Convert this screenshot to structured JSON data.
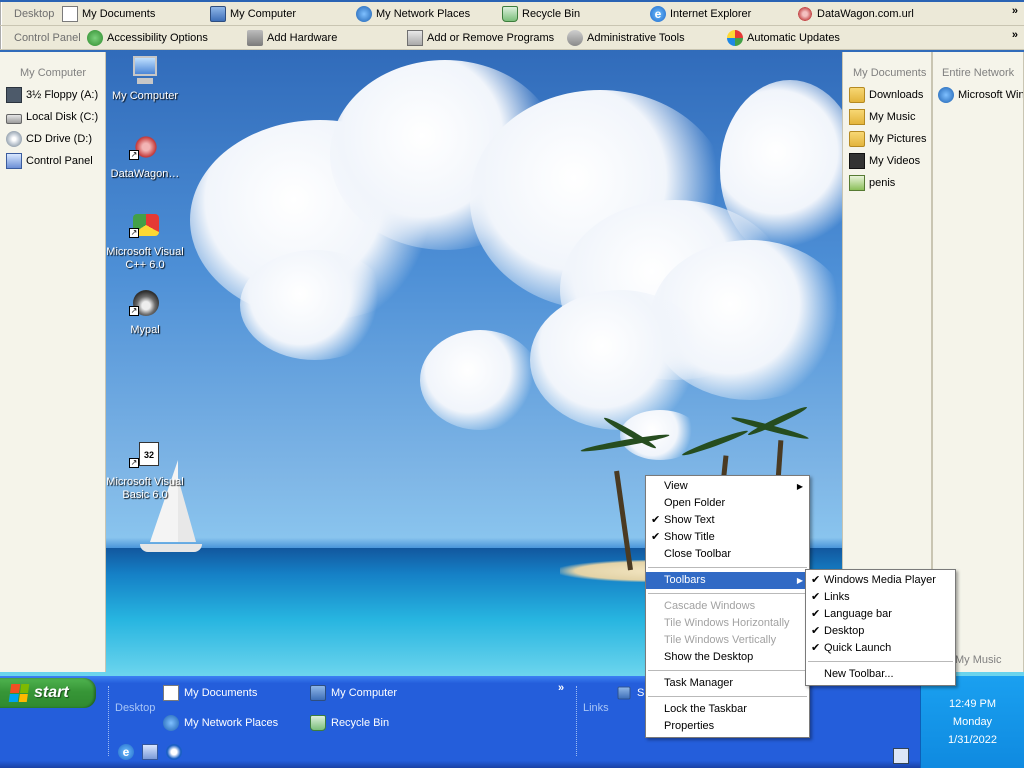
{
  "top_toolbar_1": {
    "label": "Desktop",
    "items": [
      {
        "label": "My Documents",
        "icon": "documents-folder-icon"
      },
      {
        "label": "My Computer",
        "icon": "computer-icon"
      },
      {
        "label": "My Network Places",
        "icon": "network-places-icon"
      },
      {
        "label": "Recycle Bin",
        "icon": "recycle-bin-icon"
      },
      {
        "label": "Internet Explorer",
        "icon": "internet-explorer-icon"
      },
      {
        "label": "DataWagon.com.url",
        "icon": "url-shortcut-icon"
      }
    ],
    "chevron": "»"
  },
  "top_toolbar_2": {
    "label": "Control Panel",
    "items": [
      {
        "label": "Accessibility Options",
        "icon": "accessibility-icon"
      },
      {
        "label": "Add Hardware",
        "icon": "add-hardware-icon"
      },
      {
        "label": "Add or Remove Programs",
        "icon": "add-remove-programs-icon"
      },
      {
        "label": "Administrative Tools",
        "icon": "admin-tools-icon"
      },
      {
        "label": "Automatic Updates",
        "icon": "automatic-updates-icon"
      }
    ],
    "chevron": "»"
  },
  "left_panel": {
    "title": "My Computer",
    "items": [
      {
        "label": "3½ Floppy (A:)",
        "icon": "floppy-icon"
      },
      {
        "label": "Local Disk (C:)",
        "icon": "hard-disk-icon"
      },
      {
        "label": "CD Drive (D:)",
        "icon": "cd-drive-icon"
      },
      {
        "label": "Control Panel",
        "icon": "control-panel-icon"
      }
    ]
  },
  "right_panel_docs": {
    "title": "My Documents",
    "items": [
      {
        "label": "Downloads",
        "icon": "folder-icon"
      },
      {
        "label": "My Music",
        "icon": "music-folder-icon"
      },
      {
        "label": "My Pictures",
        "icon": "pictures-folder-icon"
      },
      {
        "label": "My Videos",
        "icon": "videos-folder-icon"
      },
      {
        "label": "penis",
        "icon": "image-file-icon"
      }
    ]
  },
  "right_panel_network": {
    "title": "Entire Network",
    "items": [
      {
        "label": "Microsoft Win",
        "icon": "network-icon"
      }
    ]
  },
  "right_panel_music_label": "My Music",
  "desktop_icons": [
    {
      "label": "My Computer",
      "icon": "my-computer-desktop-icon"
    },
    {
      "label": "DataWagon…",
      "icon": "datawagon-shortcut-icon"
    },
    {
      "label": "Microsoft Visual C++ 6.0",
      "icon": "visual-cpp-icon"
    },
    {
      "label": "Mypal",
      "icon": "mypal-browser-icon"
    },
    {
      "label": "Microsoft Visual Basic 6.0",
      "icon": "visual-basic-icon"
    }
  ],
  "context_menu": {
    "items": [
      {
        "label": "View",
        "submenu": true
      },
      {
        "label": "Open Folder"
      },
      {
        "label": "Show Text",
        "checked": true
      },
      {
        "label": "Show Title",
        "checked": true
      },
      {
        "label": "Close Toolbar"
      },
      {
        "label": "Toolbars",
        "submenu": true,
        "highlighted": true
      },
      {
        "label": "Cascade Windows",
        "disabled": true
      },
      {
        "label": "Tile Windows Horizontally",
        "disabled": true
      },
      {
        "label": "Tile Windows Vertically",
        "disabled": true
      },
      {
        "label": "Show the Desktop"
      },
      {
        "label": "Task Manager"
      },
      {
        "label": "Lock the Taskbar"
      },
      {
        "label": "Properties"
      }
    ]
  },
  "toolbars_submenu": {
    "items": [
      {
        "label": "Windows Media Player",
        "checked": true
      },
      {
        "label": "Links",
        "checked": true
      },
      {
        "label": "Language bar",
        "checked": true
      },
      {
        "label": "Desktop",
        "checked": true
      },
      {
        "label": "Quick Launch",
        "checked": true
      },
      {
        "label": "New Toolbar..."
      }
    ]
  },
  "taskbar": {
    "start_label": "start",
    "desktop_toolbar_label": "Desktop",
    "links_label": "Links",
    "items": [
      {
        "label": "My Documents",
        "icon": "documents-folder-icon"
      },
      {
        "label": "My Computer",
        "icon": "computer-icon"
      },
      {
        "label": "My Network Places",
        "icon": "network-places-icon"
      },
      {
        "label": "Recycle Bin",
        "icon": "recycle-bin-icon"
      }
    ],
    "links_partial": "Su",
    "chevron": "»",
    "quick_launch": [
      "internet-explorer-icon",
      "show-desktop-icon",
      "media-player-icon"
    ]
  },
  "clock": {
    "time": "12:49 PM",
    "day": "Monday",
    "date": "1/31/2022"
  },
  "colors": {
    "taskbar_blue": "#245edb",
    "start_green": "#379637",
    "menu_highlight": "#316ac5",
    "tray_blue": "#0f8ae0"
  }
}
